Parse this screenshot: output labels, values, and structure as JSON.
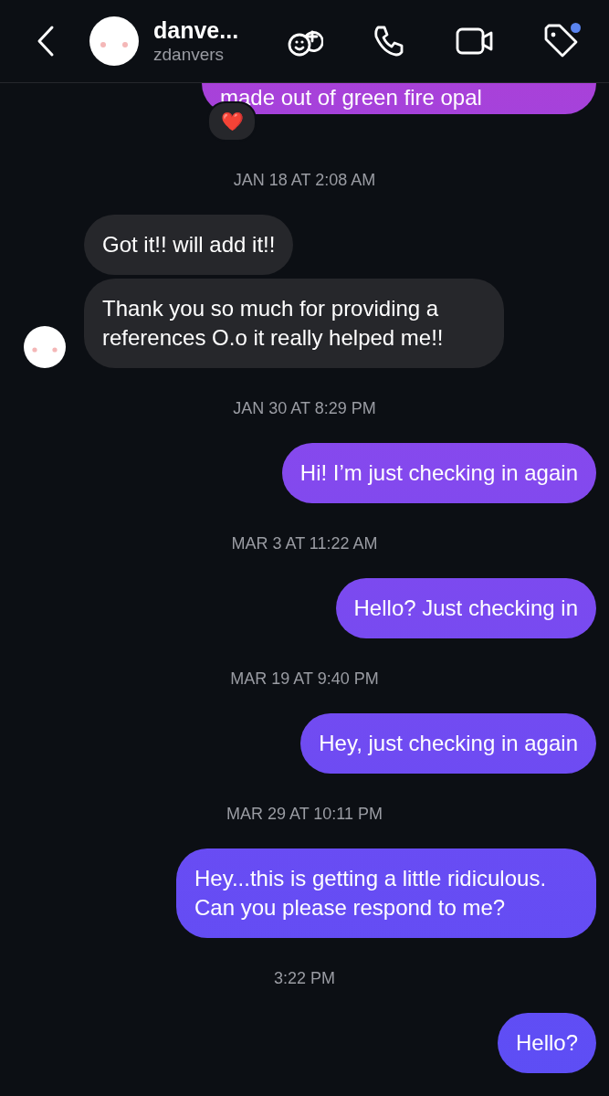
{
  "header": {
    "name": "danve...",
    "username": "zdanvers",
    "tag_unread": true
  },
  "messages": [
    {
      "kind": "outgoing",
      "text": "made out of green fire opal",
      "reaction": "❤️"
    },
    {
      "kind": "timestamp",
      "text": "JAN 18 AT 2:08 AM"
    },
    {
      "kind": "incoming",
      "text": "Got it!! will add it!!",
      "show_avatar": false
    },
    {
      "kind": "incoming",
      "text": "Thank you so much for providing a references O.o it really helped me!!",
      "show_avatar": true
    },
    {
      "kind": "timestamp",
      "text": "JAN 30 AT 8:29 PM"
    },
    {
      "kind": "outgoing",
      "text": "Hi! I’m just checking in again"
    },
    {
      "kind": "timestamp",
      "text": "MAR 3 AT 11:22 AM"
    },
    {
      "kind": "outgoing",
      "text": "Hello? Just checking in"
    },
    {
      "kind": "timestamp",
      "text": "MAR 19 AT 9:40 PM"
    },
    {
      "kind": "outgoing",
      "text": "Hey, just checking in again"
    },
    {
      "kind": "timestamp",
      "text": "MAR 29 AT 10:11 PM"
    },
    {
      "kind": "outgoing",
      "text": "Hey...this is getting a little ridiculous. Can you please respond to me?"
    },
    {
      "kind": "timestamp",
      "text": "3:22 PM"
    },
    {
      "kind": "outgoing",
      "text": "Hello?"
    }
  ]
}
